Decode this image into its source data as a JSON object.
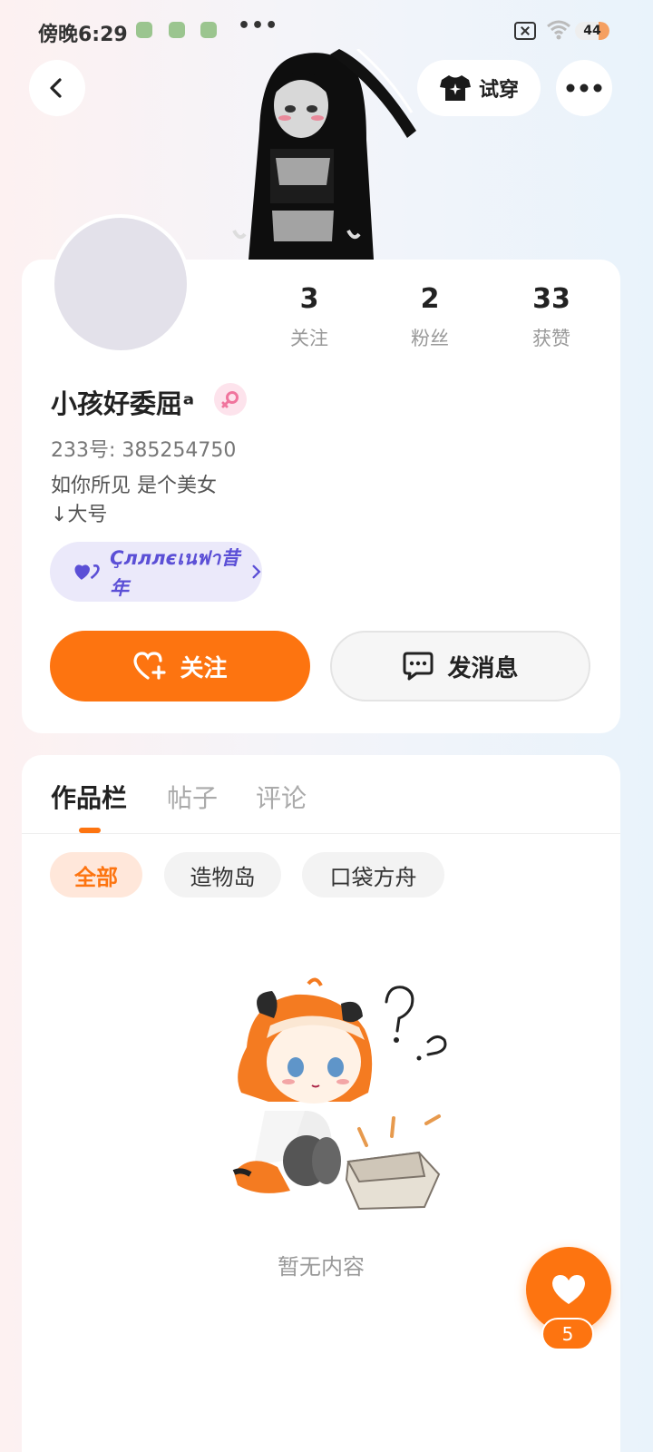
{
  "status_bar": {
    "time": "傍晚6:29",
    "more_dots": "•••",
    "battery": "44"
  },
  "header": {
    "try_on_label": "试穿",
    "back_icon": "chevron-left-icon",
    "more_icon": "ellipsis-icon"
  },
  "profile": {
    "stats": [
      {
        "value": "3",
        "label": "关注"
      },
      {
        "value": "2",
        "label": "粉丝"
      },
      {
        "value": "33",
        "label": "获赞"
      }
    ],
    "username": "小孩好委屈ᵃ",
    "gender": "female",
    "uid": "233号: 385254750",
    "bio_line1": "如你所见 是个美女",
    "bio_line2": "↓大号",
    "guild_name": "Ҫлллєเนฟา昔年",
    "follow_label": "关注",
    "message_label": "发消息"
  },
  "tabs": [
    {
      "label": "作品栏",
      "active": true
    },
    {
      "label": "帖子",
      "active": false
    },
    {
      "label": "评论",
      "active": false
    }
  ],
  "chips": [
    {
      "label": "全部",
      "active": true
    },
    {
      "label": "造物岛",
      "active": false
    },
    {
      "label": "口袋方舟",
      "active": false
    }
  ],
  "empty_state": {
    "text": "暂无内容"
  },
  "like": {
    "count": "5"
  },
  "colors": {
    "accent": "#fd7410",
    "guild": "#5b4fd6",
    "gender_badge": "#f0759d"
  }
}
